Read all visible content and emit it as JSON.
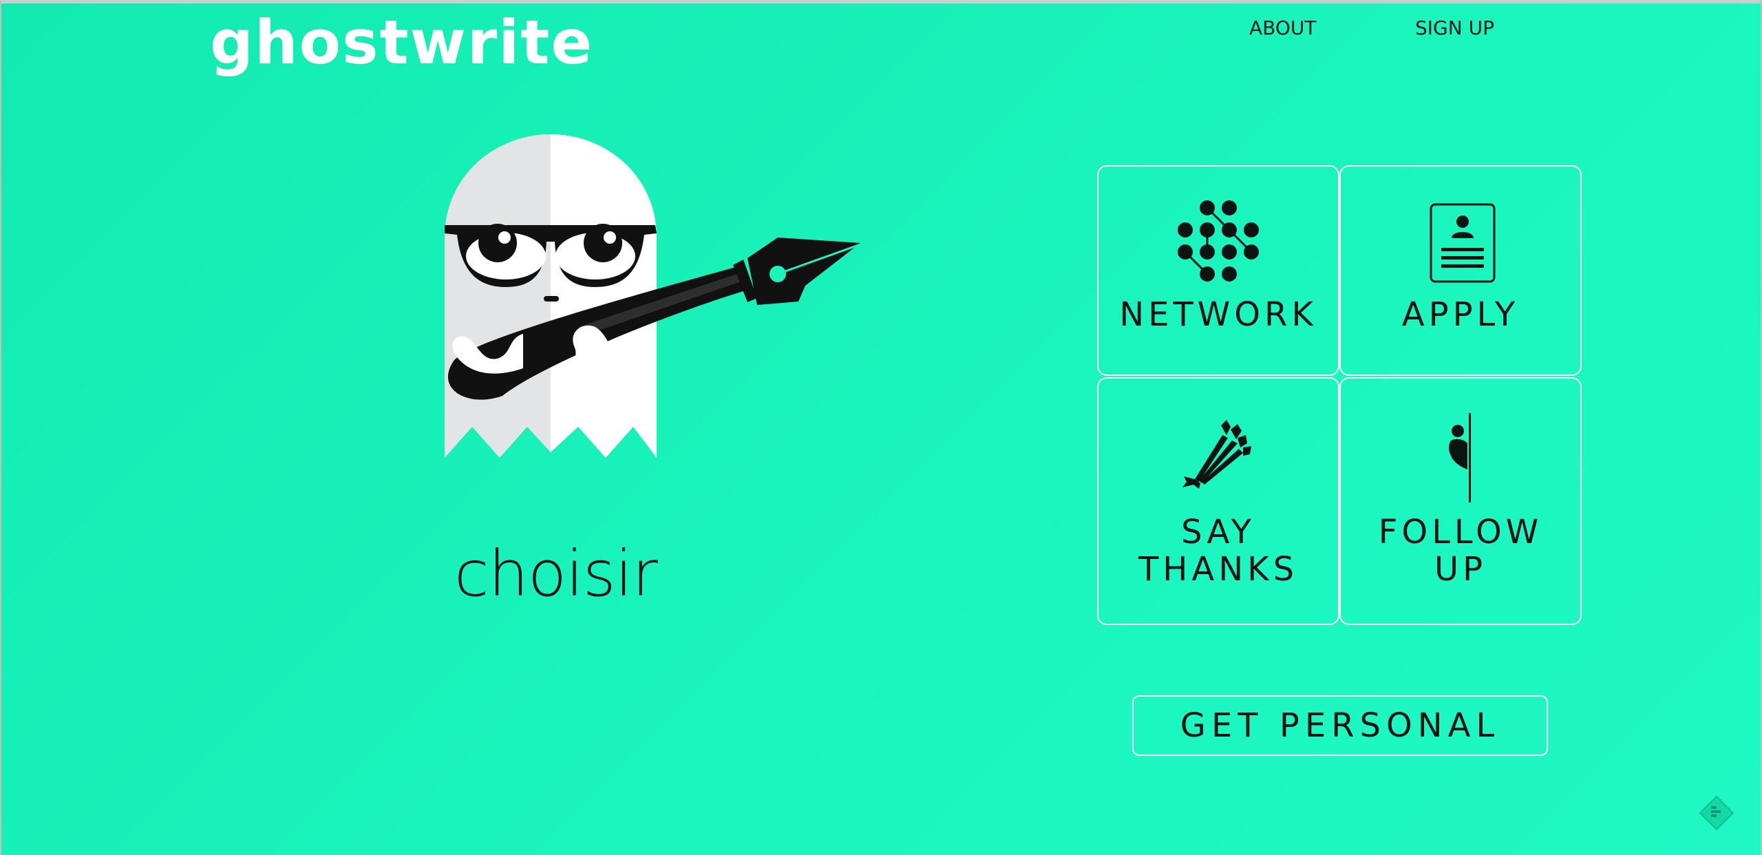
{
  "header": {
    "logo_text": "ghostwrite",
    "nav": [
      {
        "label": "ABOUT"
      },
      {
        "label": "SIGN UP"
      }
    ]
  },
  "hero": {
    "ghost_icon": "ghost-with-glasses-and-fountain-pen",
    "ghost_name": "choisir"
  },
  "tiles": [
    {
      "label_lines": [
        "NETWORK"
      ],
      "icon": "network-dots-icon"
    },
    {
      "label_lines": [
        "APPLY"
      ],
      "icon": "resume-card-icon"
    },
    {
      "label_lines": [
        "SAY",
        "THANKS"
      ],
      "icon": "flower-bouquet-icon"
    },
    {
      "label_lines": [
        "FOLLOW",
        "UP"
      ],
      "icon": "peeking-person-icon"
    }
  ],
  "cta": {
    "label": "GET PERSONAL"
  },
  "corner_icon": "feedly-icon",
  "colors": {
    "background": "#17efb8",
    "foreground": "#0d1513",
    "border": "#ffffff",
    "ghost_white": "#ffffff",
    "ghost_shadow": "#e2e4e6"
  }
}
